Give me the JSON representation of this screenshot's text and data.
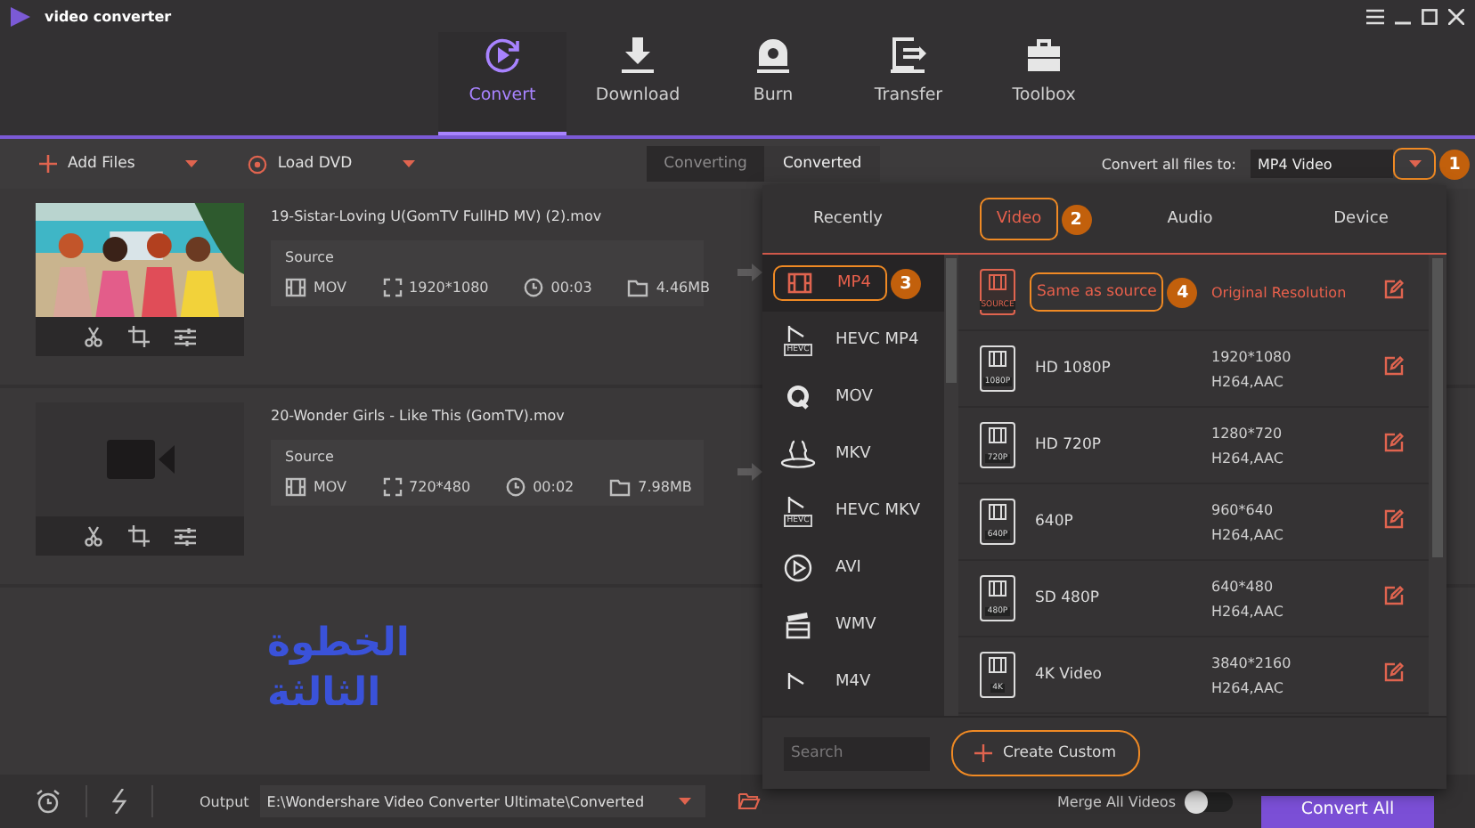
{
  "app": {
    "title": "video converter"
  },
  "nav": [
    {
      "label": "Convert",
      "kind": "convert",
      "selected": true
    },
    {
      "label": "Download",
      "kind": "download",
      "selected": false
    },
    {
      "label": "Burn",
      "kind": "burn",
      "selected": false
    },
    {
      "label": "Transfer",
      "kind": "transfer",
      "selected": false
    },
    {
      "label": "Toolbox",
      "kind": "toolbox",
      "selected": false
    }
  ],
  "toolbar": {
    "add_files": "Add Files",
    "load_dvd": "Load DVD",
    "segments": [
      {
        "label": "Converting",
        "selected": true
      },
      {
        "label": "Converted",
        "selected": false
      }
    ],
    "convert_all_label": "Convert all files to:",
    "format_value": "MP4 Video",
    "dropdown_badge": "1"
  },
  "files": [
    {
      "name": "19-Sistar-Loving U(GomTV FullHD MV) (2).mov",
      "kind": "picture",
      "source_label": "Source",
      "format": "MOV",
      "resolution": "1920*1080",
      "duration": "00:03",
      "size": "4.46MB"
    },
    {
      "name": "20-Wonder Girls - Like This (GomTV).mov",
      "kind": "empty",
      "source_label": "Source",
      "format": "MOV",
      "resolution": "720*480",
      "duration": "00:02",
      "size": "7.98MB"
    }
  ],
  "caption": [
    "الخطوة",
    "الثالثة"
  ],
  "popup": {
    "tabs": [
      {
        "label": "Recently",
        "selected": false
      },
      {
        "label": "Video",
        "selected": true,
        "badge": "2"
      },
      {
        "label": "Audio",
        "selected": false
      },
      {
        "label": "Device",
        "selected": false
      }
    ],
    "categories": [
      {
        "label": "MP4",
        "kind": "film",
        "selected": true,
        "badge": "3"
      },
      {
        "label": "HEVC MP4",
        "kind": "hevc",
        "icon_label": "HEVC",
        "selected": false
      },
      {
        "label": "MOV",
        "kind": "q",
        "selected": false
      },
      {
        "label": "MKV",
        "kind": "braces",
        "selected": false
      },
      {
        "label": "HEVC MKV",
        "kind": "hevc",
        "icon_label": "HEVC",
        "selected": false
      },
      {
        "label": "AVI",
        "kind": "play",
        "selected": false
      },
      {
        "label": "WMV",
        "kind": "clapper",
        "selected": false
      },
      {
        "label": "M4V",
        "kind": "hevc",
        "selected": false
      }
    ],
    "presets": [
      {
        "name": "Same as source",
        "icon_label": "SOURCE",
        "detail": [
          "Original Resolution"
        ],
        "selected": true,
        "badge": "4"
      },
      {
        "name": "HD 1080P",
        "icon_label": "1080P",
        "detail": [
          "1920*1080",
          "H264,AAC"
        ],
        "selected": false
      },
      {
        "name": "HD 720P",
        "icon_label": "720P",
        "detail": [
          "1280*720",
          "H264,AAC"
        ],
        "selected": false
      },
      {
        "name": "640P",
        "icon_label": "640P",
        "detail": [
          "960*640",
          "H264,AAC"
        ],
        "selected": false
      },
      {
        "name": "SD 480P",
        "icon_label": "480P",
        "detail": [
          "640*480",
          "H264,AAC"
        ],
        "selected": false
      },
      {
        "name": "4K Video",
        "icon_label": "4K",
        "detail": [
          "3840*2160",
          "H264,AAC"
        ],
        "selected": false
      }
    ],
    "search_placeholder": "Search",
    "create_custom": "Create Custom"
  },
  "bottom": {
    "output_label": "Output",
    "output_path": "E:\\Wondershare Video Converter Ultimate\\Converted",
    "merge_label": "Merge All Videos",
    "merge_on": false,
    "convert_all": "Convert All"
  }
}
